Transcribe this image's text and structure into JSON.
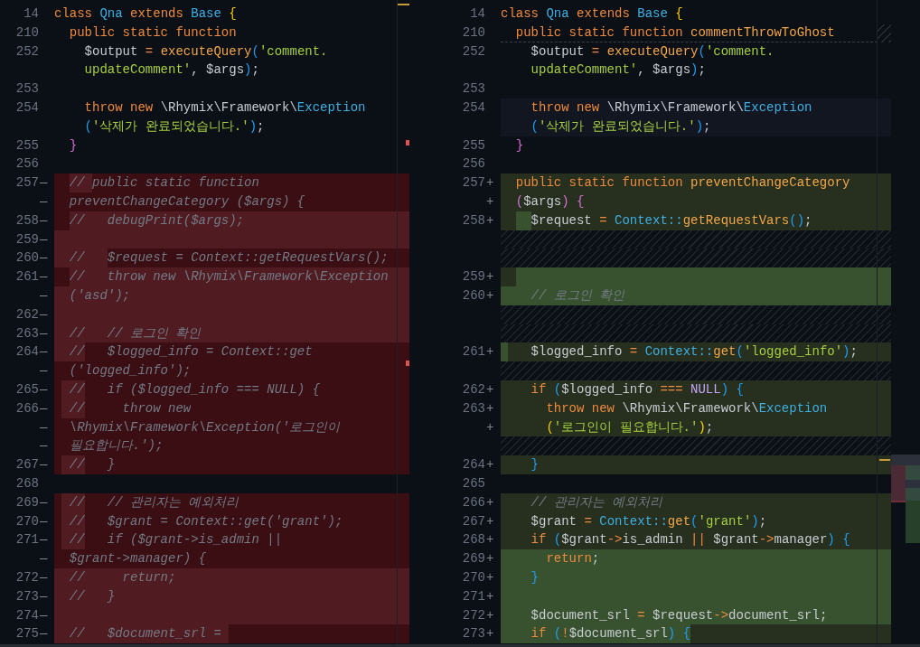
{
  "panes": [
    {
      "kind": "original",
      "sticky_divider": false,
      "lines": [
        {
          "number": "14",
          "kind": "sticky",
          "tokens": [
            {
              "kind": "keyword",
              "text": "class "
            },
            {
              "kind": "type",
              "text": "Qna "
            },
            {
              "kind": "keyword",
              "text": "extends "
            },
            {
              "kind": "type",
              "text": "Base "
            },
            {
              "kind": "bracket_1",
              "text": "{"
            }
          ]
        },
        {
          "number": "210",
          "kind": "sticky",
          "tokens": [
            {
              "kind": "keyword",
              "text": "  public static function"
            }
          ]
        },
        {
          "number": "252",
          "kind": "context",
          "tokens": [
            {
              "kind": "plain",
              "text": "    $output "
            },
            {
              "kind": "operator",
              "text": "= "
            },
            {
              "kind": "function",
              "text": "executeQuery"
            },
            {
              "kind": "bracket_3",
              "text": "("
            },
            {
              "kind": "string",
              "text": "'comment."
            }
          ]
        },
        {
          "kind": "context",
          "tokens": [
            {
              "kind": "string",
              "text": "    updateComment'"
            },
            {
              "kind": "plain",
              "text": ", $args"
            },
            {
              "kind": "bracket_3",
              "text": ")"
            },
            {
              "kind": "plain",
              "text": ";"
            }
          ]
        },
        {
          "number": "253",
          "kind": "context"
        },
        {
          "number": "254",
          "kind": "context",
          "tokens": [
            {
              "kind": "keyword",
              "text": "    throw new "
            },
            {
              "kind": "plain",
              "text": "\\Rhymix\\Framework\\"
            },
            {
              "kind": "type",
              "text": "Exception"
            }
          ]
        },
        {
          "kind": "context",
          "tokens": [
            {
              "kind": "bracket_3",
              "text": "    ("
            },
            {
              "kind": "string",
              "text": "'삭제가 완료되었습니다.'"
            },
            {
              "kind": "bracket_3",
              "text": ")"
            },
            {
              "kind": "plain",
              "text": ";"
            }
          ]
        },
        {
          "number": "255",
          "kind": "context",
          "tokens": [
            {
              "kind": "bracket_2",
              "text": "  }"
            }
          ]
        },
        {
          "number": "256",
          "kind": "context"
        },
        {
          "number": "257",
          "marker": "—",
          "kind": "removed",
          "changed": false,
          "tokens": [
            {
              "kind": "space",
              "changed": false
            },
            {
              "kind": "space",
              "changed": false
            },
            {
              "kind": "comment",
              "text": "// ",
              "changed": true
            },
            {
              "kind": "comment",
              "text": "public static function",
              "changed": false
            }
          ]
        },
        {
          "marker": "—",
          "kind": "removed",
          "changed": false,
          "tokens": [
            {
              "kind": "comment",
              "text": "  preventChangeCategory ($args) {",
              "changed": false
            }
          ]
        },
        {
          "number": "258",
          "marker": "—",
          "kind": "removed",
          "changed": true,
          "tokens": [
            {
              "kind": "space",
              "changed": false
            },
            {
              "kind": "space",
              "changed": false
            },
            {
              "kind": "comment",
              "text": "//   debugPrint($args);",
              "changed": true
            }
          ]
        },
        {
          "number": "259",
          "marker": "—",
          "kind": "removed",
          "changed": true
        },
        {
          "number": "260",
          "marker": "—",
          "kind": "removed",
          "changed": false,
          "tokens": [
            {
              "kind": "comment",
              "text": "  //   ",
              "changed": true
            },
            {
              "kind": "comment",
              "text": "$request = Context::getRequestVars();",
              "changed": false
            }
          ]
        },
        {
          "number": "261",
          "marker": "—",
          "kind": "removed",
          "changed": true,
          "tokens": [
            {
              "kind": "space",
              "changed": false
            },
            {
              "kind": "space",
              "changed": false
            },
            {
              "kind": "comment",
              "text": "//   throw new \\Rhymix\\Framework\\Exception",
              "changed": true
            }
          ]
        },
        {
          "marker": "—",
          "kind": "removed",
          "changed": true,
          "tokens": [
            {
              "kind": "comment",
              "text": "  ('asd');",
              "changed": true
            }
          ]
        },
        {
          "number": "262",
          "marker": "—",
          "kind": "removed",
          "changed": true
        },
        {
          "number": "263",
          "marker": "—",
          "kind": "removed",
          "changed": true,
          "tokens": [
            {
              "kind": "comment",
              "text": "  //   // 로그인 확인",
              "changed": true
            }
          ]
        },
        {
          "number": "264",
          "marker": "—",
          "kind": "removed",
          "changed": false,
          "tokens": [
            {
              "kind": "comment",
              "text": "  //",
              "changed": true
            },
            {
              "kind": "comment",
              "text": "   $logged_info = Context::get",
              "changed": false
            }
          ]
        },
        {
          "marker": "—",
          "kind": "removed",
          "changed": false,
          "tokens": [
            {
              "kind": "comment",
              "text": "  ('logged_info');",
              "changed": false
            }
          ]
        },
        {
          "number": "265",
          "marker": "—",
          "kind": "removed",
          "changed": false,
          "tokens": [
            {
              "kind": "space",
              "changed": false
            },
            {
              "kind": "comment",
              "text": " //",
              "changed": true
            },
            {
              "kind": "comment",
              "text": "   if ($logged_info === NULL) {",
              "changed": false
            }
          ]
        },
        {
          "number": "266",
          "marker": "—",
          "kind": "removed",
          "changed": false,
          "tokens": [
            {
              "kind": "space",
              "changed": false
            },
            {
              "kind": "comment",
              "text": " //",
              "changed": true
            },
            {
              "kind": "comment",
              "text": "     throw new",
              "changed": false
            }
          ]
        },
        {
          "marker": "—",
          "kind": "removed",
          "changed": false,
          "tokens": [
            {
              "kind": "comment",
              "text": "  \\Rhymix\\Framework\\Exception('로그인이",
              "changed": false
            }
          ]
        },
        {
          "marker": "—",
          "kind": "removed",
          "changed": false,
          "tokens": [
            {
              "kind": "comment",
              "text": "  필요합니다.');",
              "changed": false
            }
          ]
        },
        {
          "number": "267",
          "marker": "—",
          "kind": "removed",
          "changed": false,
          "tokens": [
            {
              "kind": "space",
              "changed": false
            },
            {
              "kind": "comment",
              "text": " //",
              "changed": true
            },
            {
              "kind": "comment",
              "text": "   }",
              "changed": false
            }
          ]
        },
        {
          "number": "268",
          "kind": "context"
        },
        {
          "number": "269",
          "marker": "—",
          "kind": "removed",
          "changed": false,
          "tokens": [
            {
              "kind": "space",
              "changed": false
            },
            {
              "kind": "comment",
              "text": " //",
              "changed": true
            },
            {
              "kind": "comment",
              "text": "   // 관리자는 예외처리",
              "changed": false
            }
          ]
        },
        {
          "number": "270",
          "marker": "—",
          "kind": "removed",
          "changed": false,
          "tokens": [
            {
              "kind": "space",
              "changed": false
            },
            {
              "kind": "comment",
              "text": " //",
              "changed": true
            },
            {
              "kind": "comment",
              "text": "   $grant = Context::get('grant');",
              "changed": false
            }
          ]
        },
        {
          "number": "271",
          "marker": "—",
          "kind": "removed",
          "changed": false,
          "tokens": [
            {
              "kind": "space",
              "changed": false
            },
            {
              "kind": "comment",
              "text": " //",
              "changed": true
            },
            {
              "kind": "comment",
              "text": "   if ($grant->is_admin ||",
              "changed": false
            }
          ]
        },
        {
          "marker": "—",
          "kind": "removed",
          "changed": false,
          "tokens": [
            {
              "kind": "comment",
              "text": "  $grant->manager) {",
              "changed": false
            }
          ]
        },
        {
          "number": "272",
          "marker": "—",
          "kind": "removed",
          "changed": true,
          "tokens": [
            {
              "kind": "comment",
              "text": "  //     return;",
              "changed": true
            }
          ]
        },
        {
          "number": "273",
          "marker": "—",
          "kind": "removed",
          "changed": true,
          "tokens": [
            {
              "kind": "comment",
              "text": "  //   }",
              "changed": true
            }
          ]
        },
        {
          "number": "274",
          "marker": "—",
          "kind": "removed",
          "changed": true
        },
        {
          "number": "275",
          "marker": "—",
          "kind": "removed",
          "changed": false,
          "tokens": [
            {
              "kind": "comment",
              "text": "  //   $document_srl = ",
              "changed": true
            }
          ]
        }
      ]
    },
    {
      "kind": "modified",
      "sticky_divider": true,
      "lines": [
        {
          "number": "14",
          "kind": "sticky",
          "tokens": [
            {
              "kind": "keyword",
              "text": "class "
            },
            {
              "kind": "type",
              "text": "Qna "
            },
            {
              "kind": "keyword",
              "text": "extends "
            },
            {
              "kind": "type",
              "text": "Base "
            },
            {
              "kind": "bracket_1",
              "text": "{"
            }
          ]
        },
        {
          "number": "210",
          "kind": "sticky",
          "tokens": [
            {
              "kind": "keyword",
              "text": "  public static function "
            },
            {
              "kind": "function",
              "text": "commentThrowToGhost"
            }
          ]
        },
        {
          "number": "252",
          "kind": "context",
          "tokens": [
            {
              "kind": "plain",
              "text": "    $output "
            },
            {
              "kind": "operator",
              "text": "= "
            },
            {
              "kind": "function",
              "text": "executeQuery"
            },
            {
              "kind": "bracket_3",
              "text": "("
            },
            {
              "kind": "string",
              "text": "'comment."
            }
          ]
        },
        {
          "kind": "context",
          "tokens": [
            {
              "kind": "string",
              "text": "    updateComment'"
            },
            {
              "kind": "plain",
              "text": ", $args"
            },
            {
              "kind": "bracket_3",
              "text": ")"
            },
            {
              "kind": "plain",
              "text": ";"
            }
          ]
        },
        {
          "number": "253",
          "kind": "context"
        },
        {
          "number": "254",
          "kind": "current",
          "tokens": [
            {
              "kind": "keyword",
              "text": "    throw new "
            },
            {
              "kind": "plain",
              "text": "\\Rhymix\\Framework\\"
            },
            {
              "kind": "type",
              "text": "Exception"
            }
          ]
        },
        {
          "kind": "current",
          "tokens": [
            {
              "kind": "bracket_3",
              "text": "    ("
            },
            {
              "kind": "string",
              "text": "'삭제가 완료되었습니다.'"
            },
            {
              "kind": "bracket_3",
              "text": ")"
            },
            {
              "kind": "plain",
              "text": ";"
            }
          ]
        },
        {
          "number": "255",
          "kind": "context",
          "tokens": [
            {
              "kind": "bracket_2",
              "text": "  }"
            }
          ]
        },
        {
          "number": "256",
          "kind": "context"
        },
        {
          "number": "257",
          "marker": "+",
          "kind": "added",
          "changed": false,
          "tokens": [
            {
              "kind": "keyword",
              "text": "  public static function ",
              "changed": false
            },
            {
              "kind": "function",
              "text": "preventChangeCategory",
              "changed": false
            }
          ]
        },
        {
          "marker": "+",
          "kind": "added",
          "changed": false,
          "tokens": [
            {
              "kind": "bracket_2",
              "text": "  (",
              "changed": false
            },
            {
              "kind": "plain",
              "text": "$args",
              "changed": false
            },
            {
              "kind": "bracket_2",
              "text": ") {",
              "changed": false
            }
          ]
        },
        {
          "number": "258",
          "marker": "+",
          "kind": "added",
          "changed": false,
          "tokens": [
            {
              "kind": "space",
              "changed": false
            },
            {
              "kind": "space",
              "changed": false
            },
            {
              "kind": "space",
              "changed": true
            },
            {
              "kind": "space",
              "changed": true
            },
            {
              "kind": "plain",
              "text": "$request ",
              "changed": false
            },
            {
              "kind": "operator",
              "text": "= ",
              "changed": false
            },
            {
              "kind": "type",
              "text": "Context::",
              "changed": false
            },
            {
              "kind": "function",
              "text": "getRequestVars",
              "changed": false
            },
            {
              "kind": "bracket_3",
              "text": "()",
              "changed": false
            },
            {
              "kind": "plain",
              "text": ";",
              "changed": false
            }
          ]
        },
        {
          "kind": "filler"
        },
        {
          "kind": "filler"
        },
        {
          "number": "259",
          "marker": "+",
          "kind": "added",
          "changed": true,
          "tokens": [
            {
              "kind": "space",
              "changed": false
            },
            {
              "kind": "space",
              "changed": false
            }
          ]
        },
        {
          "number": "260",
          "marker": "+",
          "kind": "added",
          "changed": true,
          "tokens": [
            {
              "kind": "comment",
              "text": "    // 로그인 확인",
              "changed": true
            }
          ]
        },
        {
          "kind": "filler"
        },
        {
          "kind": "filler"
        },
        {
          "number": "261",
          "marker": "+",
          "kind": "added",
          "changed": false,
          "tokens": [
            {
              "kind": "space",
              "changed": true
            },
            {
              "kind": "plain",
              "text": "   $logged_info ",
              "changed": false
            },
            {
              "kind": "operator",
              "text": "= ",
              "changed": false
            },
            {
              "kind": "type",
              "text": "Context::",
              "changed": false
            },
            {
              "kind": "function",
              "text": "get",
              "changed": false
            },
            {
              "kind": "bracket_3",
              "text": "(",
              "changed": false
            },
            {
              "kind": "string",
              "text": "'logged_info'",
              "changed": false
            },
            {
              "kind": "bracket_3",
              "text": ")",
              "changed": false
            },
            {
              "kind": "plain",
              "text": ";",
              "changed": false
            }
          ]
        },
        {
          "kind": "filler"
        },
        {
          "number": "262",
          "marker": "+",
          "kind": "added",
          "changed": false,
          "tokens": [
            {
              "kind": "keyword",
              "text": "    if ",
              "changed": false
            },
            {
              "kind": "bracket_3",
              "text": "(",
              "changed": false
            },
            {
              "kind": "plain",
              "text": "$logged_info ",
              "changed": false
            },
            {
              "kind": "operator",
              "text": "=== ",
              "changed": false
            },
            {
              "kind": "constant",
              "text": "NULL",
              "changed": false
            },
            {
              "kind": "bracket_3",
              "text": ") {",
              "changed": false
            }
          ]
        },
        {
          "number": "263",
          "marker": "+",
          "kind": "added",
          "changed": false,
          "tokens": [
            {
              "kind": "keyword",
              "text": "      throw new ",
              "changed": false
            },
            {
              "kind": "plain",
              "text": "\\Rhymix\\Framework\\",
              "changed": false
            },
            {
              "kind": "type",
              "text": "Exception",
              "changed": false
            }
          ]
        },
        {
          "marker": "+",
          "kind": "added",
          "changed": false,
          "tokens": [
            {
              "kind": "bracket_1",
              "text": "      (",
              "changed": false
            },
            {
              "kind": "string",
              "text": "'로그인이 필요합니다.'",
              "changed": false
            },
            {
              "kind": "bracket_1",
              "text": ")",
              "changed": false
            },
            {
              "kind": "plain",
              "text": ";",
              "changed": false
            }
          ]
        },
        {
          "kind": "filler"
        },
        {
          "number": "264",
          "marker": "+",
          "kind": "added",
          "changed": false,
          "tokens": [
            {
              "kind": "bracket_3",
              "text": "    }",
              "changed": false
            }
          ]
        },
        {
          "number": "265",
          "kind": "context"
        },
        {
          "number": "266",
          "marker": "+",
          "kind": "added",
          "changed": false,
          "tokens": [
            {
              "kind": "comment",
              "text": "    // 관리자는 예외처리",
              "changed": false
            }
          ]
        },
        {
          "number": "267",
          "marker": "+",
          "kind": "added",
          "changed": false,
          "tokens": [
            {
              "kind": "plain",
              "text": "    $grant ",
              "changed": false
            },
            {
              "kind": "operator",
              "text": "= ",
              "changed": false
            },
            {
              "kind": "type",
              "text": "Context::",
              "changed": false
            },
            {
              "kind": "function",
              "text": "get",
              "changed": false
            },
            {
              "kind": "bracket_3",
              "text": "(",
              "changed": false
            },
            {
              "kind": "string",
              "text": "'grant'",
              "changed": false
            },
            {
              "kind": "bracket_3",
              "text": ")",
              "changed": false
            },
            {
              "kind": "plain",
              "text": ";",
              "changed": false
            }
          ]
        },
        {
          "number": "268",
          "marker": "+",
          "kind": "added",
          "changed": false,
          "tokens": [
            {
              "kind": "keyword",
              "text": "    if ",
              "changed": false
            },
            {
              "kind": "bracket_3",
              "text": "(",
              "changed": false
            },
            {
              "kind": "plain",
              "text": "$grant",
              "changed": false
            },
            {
              "kind": "operator",
              "text": "->",
              "changed": false
            },
            {
              "kind": "plain",
              "text": "is_admin ",
              "changed": false
            },
            {
              "kind": "operator",
              "text": "|| ",
              "changed": false
            },
            {
              "kind": "plain",
              "text": "$grant",
              "changed": false
            },
            {
              "kind": "operator",
              "text": "->",
              "changed": false
            },
            {
              "kind": "plain",
              "text": "manager",
              "changed": false
            },
            {
              "kind": "bracket_3",
              "text": ") {",
              "changed": false
            }
          ]
        },
        {
          "number": "269",
          "marker": "+",
          "kind": "added",
          "changed": true,
          "tokens": [
            {
              "kind": "keyword",
              "text": "      return",
              "changed": true
            },
            {
              "kind": "plain",
              "text": ";",
              "changed": true
            }
          ]
        },
        {
          "number": "270",
          "marker": "+",
          "kind": "added",
          "changed": true,
          "tokens": [
            {
              "kind": "bracket_3",
              "text": "    }",
              "changed": true
            }
          ]
        },
        {
          "number": "271",
          "marker": "+",
          "kind": "added",
          "changed": true
        },
        {
          "number": "272",
          "marker": "+",
          "kind": "added",
          "changed": true,
          "tokens": [
            {
              "kind": "plain",
              "text": "    $document_srl ",
              "changed": true
            },
            {
              "kind": "operator",
              "text": "= ",
              "changed": true
            },
            {
              "kind": "plain",
              "text": "$request",
              "changed": true
            },
            {
              "kind": "operator",
              "text": "->",
              "changed": true
            },
            {
              "kind": "plain",
              "text": "document_srl;",
              "changed": true
            }
          ]
        },
        {
          "number": "273",
          "marker": "+",
          "kind": "added",
          "changed": false,
          "tokens": [
            {
              "kind": "keyword",
              "text": "    if ",
              "changed": true
            },
            {
              "kind": "bracket_3",
              "text": "(",
              "changed": true
            },
            {
              "kind": "operator",
              "text": "!",
              "changed": true
            },
            {
              "kind": "plain",
              "text": "$document_srl",
              "changed": true
            },
            {
              "kind": "bracket_3",
              "text": ") {",
              "changed": true
            }
          ]
        }
      ]
    }
  ]
}
